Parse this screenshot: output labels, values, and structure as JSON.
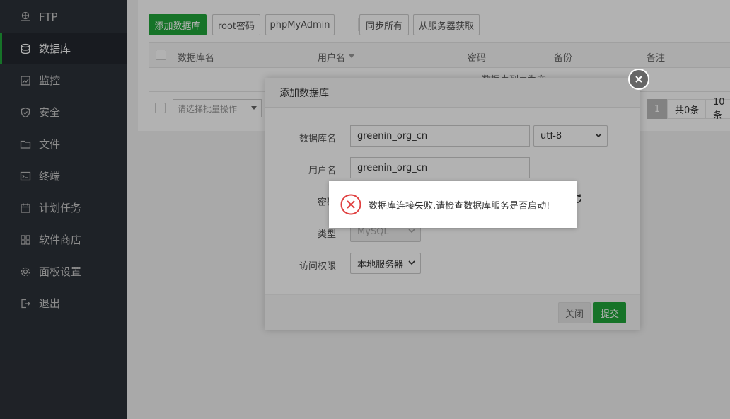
{
  "sidebar": {
    "items": [
      {
        "label": "FTP",
        "icon": "globe-icon"
      },
      {
        "label": "数据库",
        "icon": "database-icon",
        "active": true
      },
      {
        "label": "监控",
        "icon": "monitor-icon"
      },
      {
        "label": "安全",
        "icon": "shield-icon"
      },
      {
        "label": "文件",
        "icon": "folder-icon"
      },
      {
        "label": "终端",
        "icon": "terminal-icon"
      },
      {
        "label": "计划任务",
        "icon": "calendar-icon"
      },
      {
        "label": "软件商店",
        "icon": "grid-icon"
      },
      {
        "label": "面板设置",
        "icon": "gear-icon"
      },
      {
        "label": "退出",
        "icon": "logout-icon"
      }
    ]
  },
  "toolbar": {
    "add_db": "添加数据库",
    "root_pwd": "root密码",
    "phpmyadmin": "phpMyAdmin",
    "sync_all": "同步所有",
    "fetch_from_server": "从服务器获取"
  },
  "table": {
    "columns": [
      "数据库名",
      "用户名",
      "密码",
      "备份",
      "备注"
    ],
    "empty_text": "数据表列表为空"
  },
  "batch": {
    "placeholder": "请选择批量操作"
  },
  "pager": {
    "current": "1",
    "total": "共0条",
    "per_page": "10条"
  },
  "modal": {
    "title": "添加数据库",
    "fields": {
      "db_name_label": "数据库名",
      "db_name_value": "greenin_org_cn",
      "charset": "utf-8",
      "username_label": "用户名",
      "username_value": "greenin_org_cn",
      "password_label": "密码",
      "type_label": "类型",
      "type_value": "MySQL",
      "access_label": "访问权限",
      "access_value": "本地服务器"
    },
    "close_label": "关闭",
    "submit_label": "提交"
  },
  "message": {
    "text": "数据库连接失败,请检查数据库服务是否启动!",
    "icon": "error-circle-icon"
  },
  "colors": {
    "accent": "#20a53a",
    "error": "#e04040",
    "sidebar_bg": "#2c3138"
  }
}
